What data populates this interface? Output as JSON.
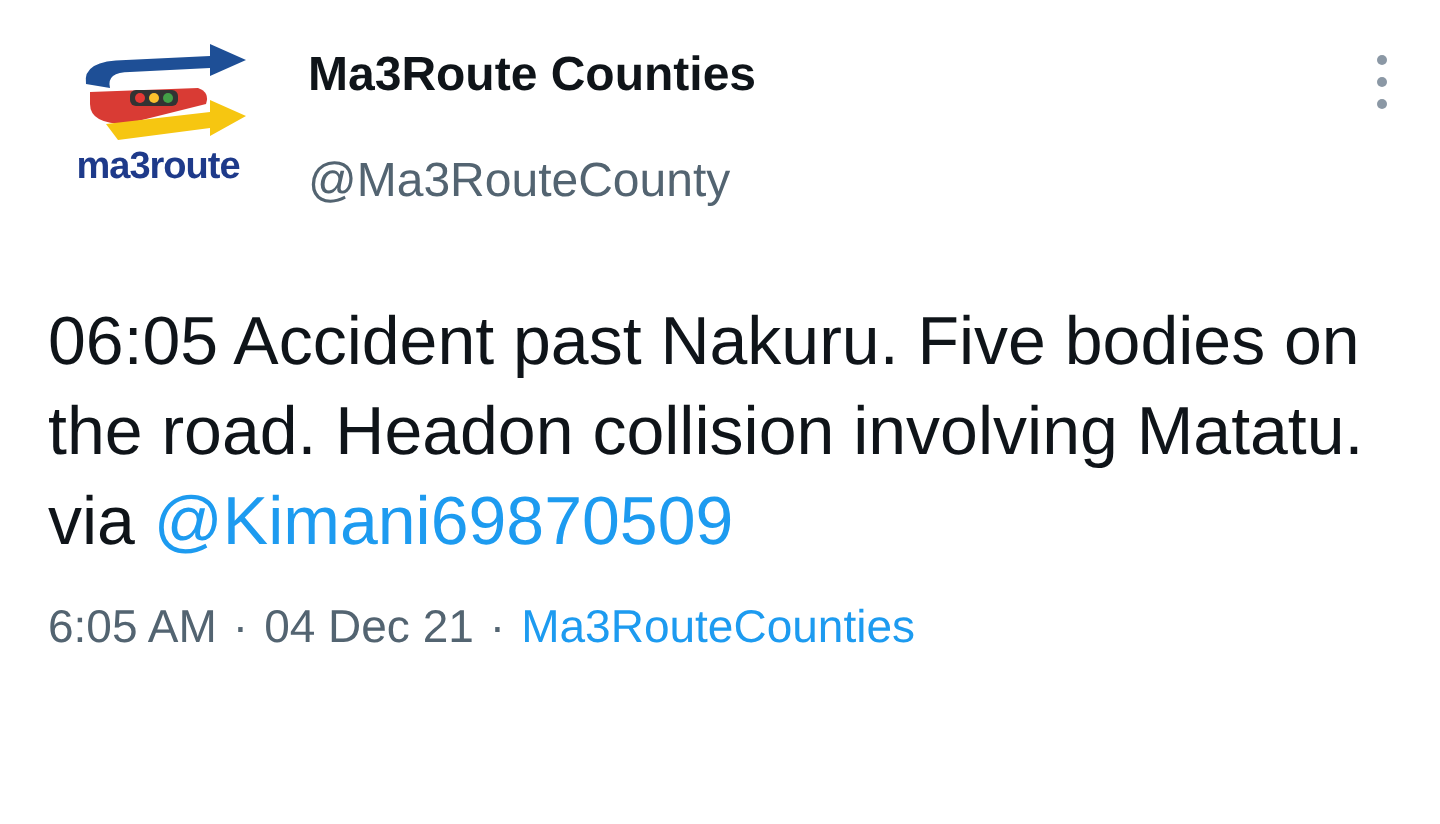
{
  "account": {
    "logo_text": "ma3route",
    "name": "Ma3Route Counties",
    "handle": "@Ma3RouteCounty"
  },
  "tweet": {
    "text": "06:05 Accident past Nakuru. Five bodies on the road. Headon collision involving Matatu. via",
    "mention": "@Kimani69870509"
  },
  "meta": {
    "time": "6:05 AM",
    "separator_1": "·",
    "date": "04 Dec 21",
    "separator_2": "·",
    "source": "Ma3RouteCounties"
  }
}
